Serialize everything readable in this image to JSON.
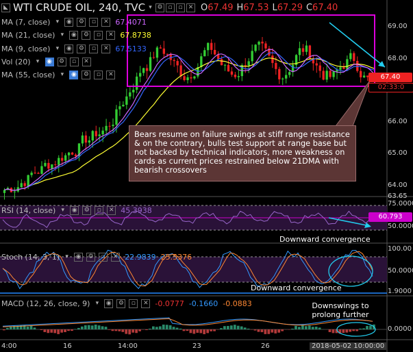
{
  "header": {
    "symbol_title": "WTI CRUDE OIL, 240, TVC",
    "open_label": "O",
    "open": "67.49",
    "high_label": "H",
    "high": "67.53",
    "low_label": "L",
    "low": "67.29",
    "close_label": "C",
    "close": "67.40"
  },
  "studies": {
    "ma7": {
      "label": "MA (7, close)",
      "value": "67.4071"
    },
    "ma21": {
      "label": "MA (21, close)",
      "value": "67.8738"
    },
    "ma9": {
      "label": "MA (9, close)",
      "value": "67.5133"
    },
    "vol": {
      "label": "Vol (20)"
    },
    "ma55": {
      "label": "MA (55, close)"
    },
    "rsi": {
      "label": "RSI (14, close)",
      "value": "45.3938"
    },
    "stoch": {
      "label": "Stoch (14, 3, 1)",
      "k": "22.9839",
      "d": "25.5376"
    },
    "macd": {
      "label": "MACD (12, 26, close, 9)",
      "hist": "-0.0777",
      "macd": "-0.1660",
      "signal": "-0.0883"
    }
  },
  "price_axis": {
    "ticks": [
      "69.00",
      "68.00",
      "67.00",
      "66.00",
      "65.00",
      "64.00"
    ],
    "last_price": "67.40",
    "countdown": "02:33:0",
    "bottom_tick": "63.65"
  },
  "rsi_axis": {
    "ticks": [
      "75.0000",
      "50.0000"
    ],
    "current": "60.793"
  },
  "stoch_axis": {
    "ticks": [
      "100.00",
      "50.0000",
      "1.9000"
    ]
  },
  "macd_axis": {
    "ticks": [
      "0.0000"
    ]
  },
  "time_axis": {
    "labels": [
      "4:00",
      "16",
      "14:00",
      "23",
      "26",
      "2018-05-02 10:00:00"
    ]
  },
  "annotations": {
    "note": "Bears resume on failure swings at stiff range resistance & on the contrary, bulls test support at range base but not backed by technical indicators, more weakness on cards as current prices restrained below 21DMA with bearish crossovers",
    "rsi_note": "Downward convergence",
    "stoch_note": "Downward convergence",
    "macd_note": "Downswings to prolong further"
  },
  "colors": {
    "bull": "#33cc33",
    "bear": "#ee2222",
    "ma7": "#cc66ff",
    "ma21": "#ffff33",
    "ma9": "#3366ff",
    "range_box": "#dd00dd",
    "arrow": "#22ccee",
    "rsi": "#9966cc",
    "stoch_k": "#3399ff",
    "stoch_d": "#ff8833",
    "accent_tag": "#ee2222"
  },
  "icons": [
    "chevron-down-icon",
    "eye-icon",
    "gear-icon",
    "settings-icon",
    "close-icon"
  ]
}
